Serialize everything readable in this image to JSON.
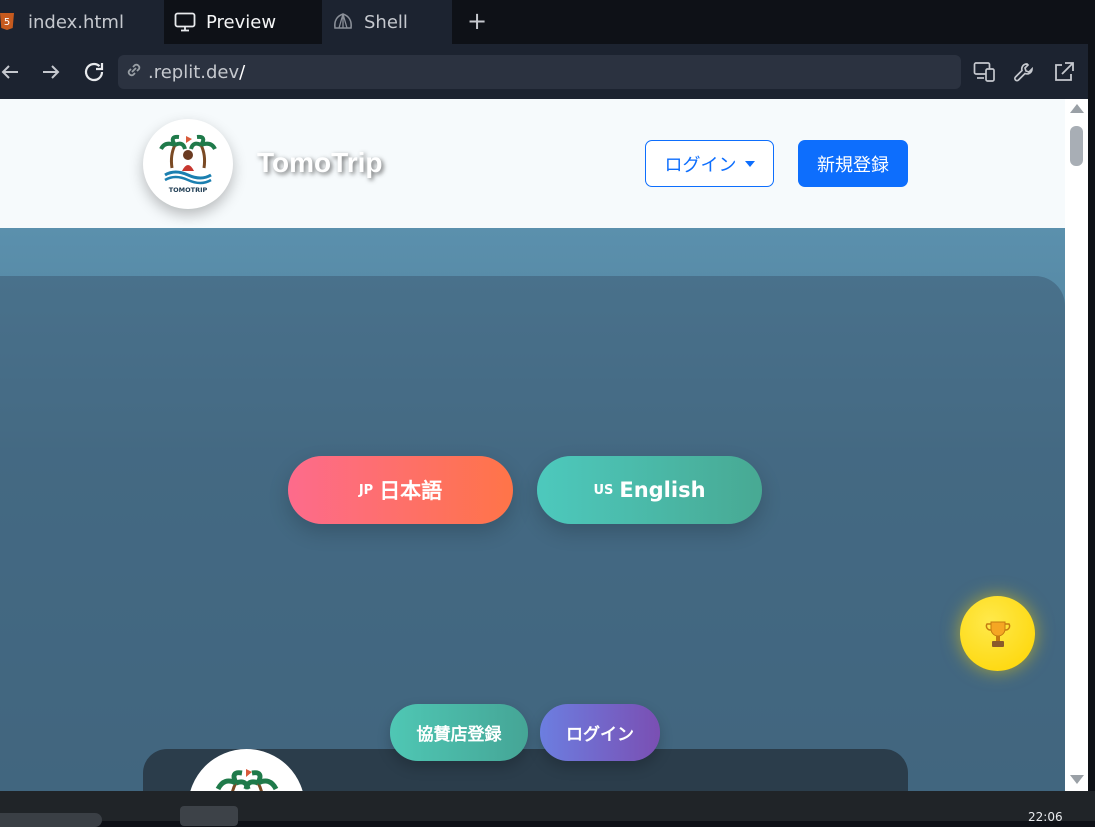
{
  "ide": {
    "tabs": [
      {
        "label": "index.html",
        "icon": "html5-icon"
      },
      {
        "label": "Preview",
        "icon": "monitor-icon"
      },
      {
        "label": "Shell",
        "icon": "shell-icon"
      }
    ],
    "new_tab_label": "+",
    "url": {
      "prefix": ".replit.dev",
      "suffix": "/"
    }
  },
  "site": {
    "brand": "TomoTrip",
    "logo_text": "TOMOTRIP",
    "header": {
      "login_label": "ログイン",
      "signup_label": "新規登録"
    },
    "languages": [
      {
        "code": "JP",
        "label": "日本語"
      },
      {
        "code": "US",
        "label": "English"
      }
    ],
    "floating": {
      "sponsor_label": "協賛店登録",
      "login_label": "ログイン"
    },
    "trophy_icon": "trophy-icon"
  },
  "taskbar": {
    "time": "22:06"
  },
  "colors": {
    "primary": "#0d6efd",
    "ja_gradient": [
      "#fd6b8c",
      "#ff7448"
    ],
    "en_gradient": [
      "#4dc9bd",
      "#48a993"
    ],
    "trophy": "#fdd400"
  }
}
